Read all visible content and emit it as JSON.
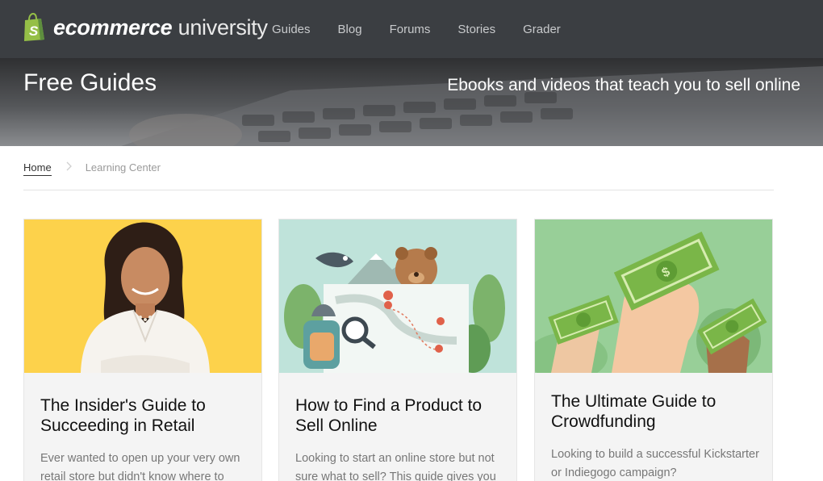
{
  "header": {
    "logo": {
      "strong": "ecommerce",
      "light": "university"
    },
    "nav": [
      "Guides",
      "Blog",
      "Forums",
      "Stories",
      "Grader"
    ]
  },
  "hero": {
    "title": "Free Guides",
    "subtitle": "Ebooks and videos that teach you to sell online"
  },
  "breadcrumb": {
    "home": "Home",
    "separator": ">",
    "current": "Learning Center"
  },
  "cards": [
    {
      "title": "The Insider's Guide to Succeeding in Retail",
      "description": "Ever wanted to open up your very own retail store but didn't know where to"
    },
    {
      "title": "How to Find a Product to Sell Online",
      "description": "Looking to start an online store but not sure what to sell? This guide gives you"
    },
    {
      "title": "The Ultimate Guide to Crowdfunding",
      "description": "Looking to build a successful Kickstarter or Indiegogo campaign?"
    }
  ],
  "colors": {
    "nav_bg": "#3b3e42",
    "shopify_green": "#95bf47",
    "card_bg": "#f4f4f4",
    "card1_img_bg": "#fdd24b",
    "card2_img_bg": "#bfe3da",
    "card3_img_bg": "#98cf98"
  }
}
